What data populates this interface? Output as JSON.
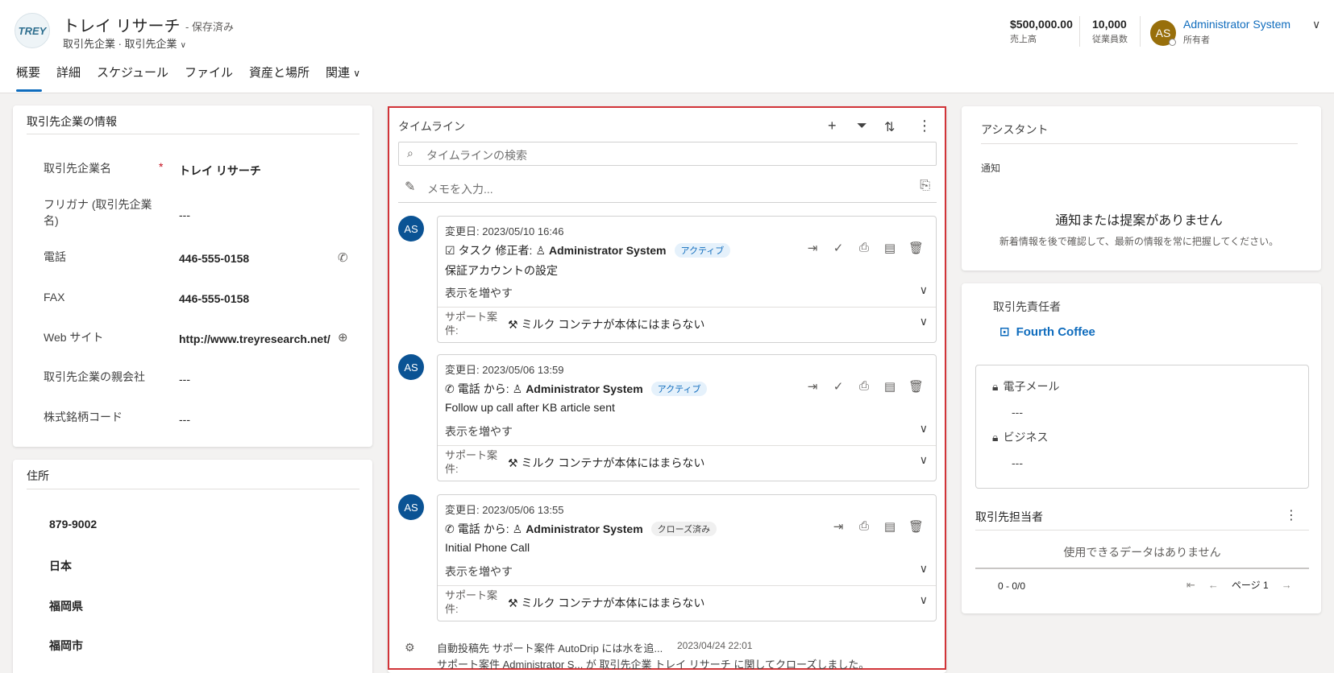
{
  "header": {
    "logo_text": "TREY",
    "title": "トレイ リサーチ",
    "saved": "- 保存済み",
    "subtitle": "取引先企業 · 取引先企業",
    "kpis": [
      {
        "value": "$500,000.00",
        "label": "売上高"
      },
      {
        "value": "10,000",
        "label": "従業員数"
      }
    ],
    "owner": {
      "initials": "AS",
      "name": "Administrator System",
      "role": "所有者"
    }
  },
  "tabs": [
    "概要",
    "詳細",
    "スケジュール",
    "ファイル",
    "資産と場所",
    "関連"
  ],
  "account_info": {
    "title": "取引先企業の情報",
    "fields": [
      {
        "label": "取引先企業名",
        "value": "トレイ リサーチ",
        "required": "*"
      },
      {
        "label": "フリガナ (取引先企業名)",
        "value": "---"
      },
      {
        "label": "電話",
        "value": "446-555-0158"
      },
      {
        "label": "FAX",
        "value": "446-555-0158"
      },
      {
        "label": "Web サイト",
        "value": "http://www.treyresearch.net/"
      },
      {
        "label": "取引先企業の親会社",
        "value": "---"
      },
      {
        "label": "株式銘柄コード",
        "value": "---"
      }
    ]
  },
  "address": {
    "title": "住所",
    "lines": [
      "879-9002",
      "日本",
      "福岡県",
      "福岡市"
    ]
  },
  "timeline": {
    "title": "タイムライン",
    "search_placeholder": "タイムラインの検索",
    "memo_placeholder": "メモを入力...",
    "items": [
      {
        "avatar": "AS",
        "date": "変更日: 2023/05/10 16:46",
        "type": "タスク",
        "by_label": "修正者:",
        "person": "Administrator System",
        "status": "アクティブ",
        "subject": "保証アカウントの設定",
        "more": "表示を増やす",
        "rel_label": "サポート案件:",
        "rel_value": "ミルク コンテナが本体にはまらない"
      },
      {
        "avatar": "AS",
        "date": "変更日: 2023/05/06 13:59",
        "type": "電話",
        "by_label": "から:",
        "person": "Administrator System",
        "status": "アクティブ",
        "subject": "Follow up call after KB article sent",
        "more": "表示を増やす",
        "rel_label": "サポート案件:",
        "rel_value": "ミルク コンテナが本体にはまらない"
      },
      {
        "avatar": "AS",
        "date": "変更日: 2023/05/06 13:55",
        "type": "電話",
        "by_label": "から:",
        "person": "Administrator System",
        "status": "クローズ済み",
        "subject": "Initial Phone Call",
        "more": "表示を増やす",
        "rel_label": "サポート案件:",
        "rel_value": "ミルク コンテナが本体にはまらない"
      }
    ],
    "auto_post": {
      "line1": "自動投稿先 サポート案件 AutoDrip には水を追...",
      "date": "2023/04/24 22:01",
      "line2": "サポート案件 Administrator S...  が 取引先企業 トレイ リサーチ に関してクローズしました。"
    }
  },
  "assistant": {
    "title": "アシスタント",
    "notice_label": "通知",
    "empty_title": "通知または提案がありません",
    "empty_sub": "新着情報を後で確認して、最新の情報を常に把握してください。"
  },
  "contact": {
    "title": "取引先責任者",
    "name": "Fourth Coffee",
    "email_label": "電子メール",
    "email_value": "---",
    "business_label": "ビジネス",
    "business_value": "---"
  },
  "related_contacts": {
    "title": "取引先担当者",
    "empty": "使用できるデータはありません",
    "count": "0 - 0/0",
    "page": "ページ 1"
  }
}
